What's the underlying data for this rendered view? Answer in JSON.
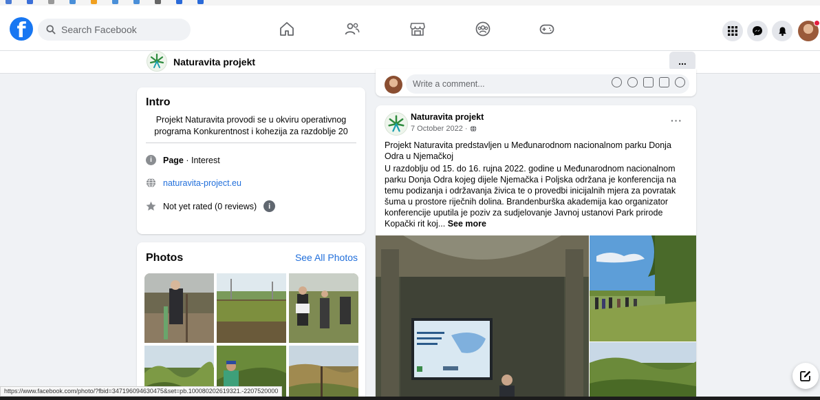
{
  "header": {
    "search_placeholder": "Search Facebook"
  },
  "page": {
    "name": "Naturavita projekt",
    "more_label": "..."
  },
  "intro": {
    "title": "Intro",
    "bio": "Projekt Naturavita provodi se u okviru operativnog programa Konkurentnost i kohezija za razdoblje 20",
    "category_bold": "Page",
    "category_rest": " · Interest",
    "website": "naturavita-project.eu",
    "rating": "Not yet rated (0 reviews)"
  },
  "photos": {
    "title": "Photos",
    "see_all": "See All Photos"
  },
  "comment": {
    "placeholder": "Write a comment..."
  },
  "post": {
    "author": "Naturavita projekt",
    "date": "7 October 2022 · ",
    "more_label": "···",
    "title": "Projekt Naturavita predstavljen u Međunarodnom nacionalnom parku Donja Odra u Njemačkoj",
    "body": "U razdoblju od 15. do 16. rujna 2022. godine u Međunarodnom nacionalnom parku Donja Odra kojeg dijele Njemačka i Poljska održana je konferencija na temu podizanja i održavanja živica te o provedbi inicijalnih mjera za povratak šuma u prostore riječnih dolina. Brandenburška akademija kao organizator konferencije uputila je poziv za sudjelovanje Javnoj ustanovi Park prirode Kopački rit koj... ",
    "see_more": "See more"
  },
  "status_url": "https://www.facebook.com/photo/?fbid=347196094630475&set=pb.100080202619321.-2207520000",
  "colors": {
    "brand": "#1877f2",
    "link": "#216fdb",
    "background": "#f0f2f5"
  }
}
